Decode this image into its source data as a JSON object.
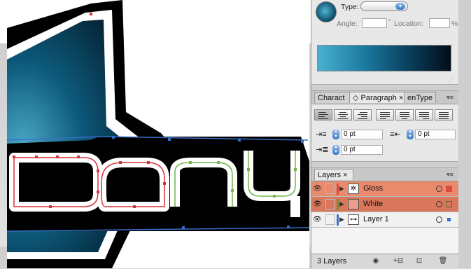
{
  "gradient_panel": {
    "type_label": "Type:",
    "type_value": "",
    "angle_label": "Angle:",
    "angle_value": "",
    "angle_unit": "°",
    "location_label": "Location:",
    "location_value": "",
    "location_unit": "%",
    "icon_name": "gradient-swatch-icon"
  },
  "text_tabs": {
    "tabs": [
      {
        "label": "Charact"
      },
      {
        "label": "◇ Paragraph ×"
      },
      {
        "label": "enType"
      }
    ],
    "menu_icon": "panel-menu-icon"
  },
  "paragraph": {
    "left_indent": "0 pt",
    "right_indent": "0 pt",
    "first_line_indent": "0 pt"
  },
  "layers": {
    "tab_label": "Layers ×",
    "rows": [
      {
        "name": "Gloss",
        "highlight": "#e98a6c",
        "bar_color": "#d94b3a",
        "thumb": "✲"
      },
      {
        "name": "White",
        "highlight": "#d9775c",
        "bar_color": "#7b8a3a",
        "thumb": ""
      },
      {
        "name": "Layer 1",
        "highlight": "#f1f1f1",
        "bar_color": "#3a6fc7",
        "thumb": "⊶"
      }
    ],
    "status": "3 Layers"
  },
  "colors": {
    "accent_blue": "#1b7aa0",
    "highlight_red": "#e98a6c"
  }
}
